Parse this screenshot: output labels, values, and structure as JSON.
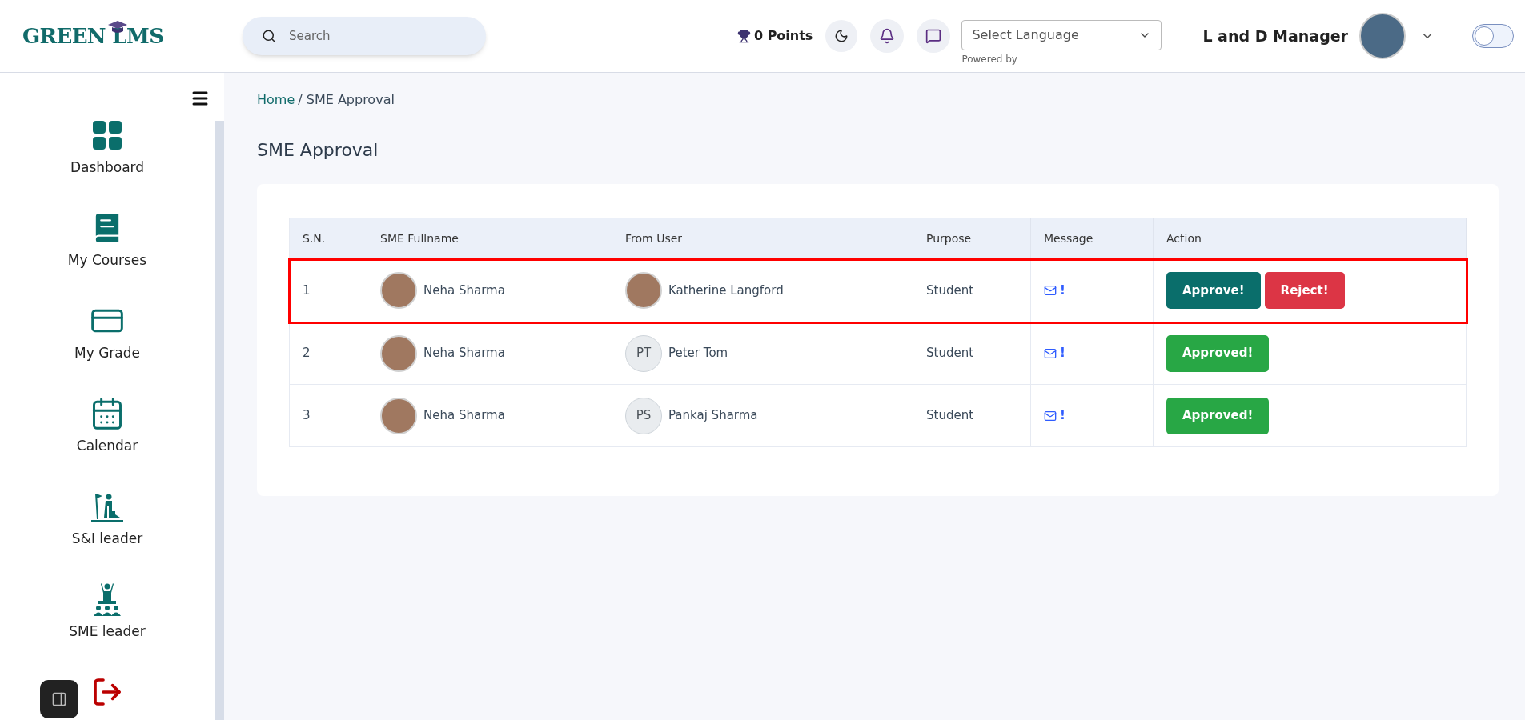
{
  "header": {
    "logo": "GREEN LMS",
    "search": {
      "placeholder": "Search"
    },
    "points": "0 Points",
    "language": {
      "value": "Select Language",
      "note": "Powered by"
    },
    "user": "L and D Manager",
    "toggle": {
      "on": false
    }
  },
  "sidebar": {
    "items": [
      {
        "label": "Dashboard",
        "kind": "grid"
      },
      {
        "label": "My Courses",
        "kind": "book"
      },
      {
        "label": "My Grade",
        "kind": "card"
      },
      {
        "label": "Calendar",
        "kind": "calendar"
      },
      {
        "label": "S&I leader",
        "kind": "climber"
      },
      {
        "label": "SME leader",
        "kind": "leader"
      },
      {
        "kind": "logout"
      }
    ]
  },
  "breadcrumb": {
    "home": "Home",
    "current": "/ SME Approval"
  },
  "page_title": "SME Approval",
  "table": {
    "columns": [
      "S.N.",
      "SME Fullname",
      "From User",
      "Purpose",
      "Message",
      "Action"
    ],
    "rows": [
      {
        "sn": "1",
        "sme": {
          "name": "Neha Sharma",
          "kind": "photo"
        },
        "from": {
          "name": "Katherine Langford",
          "kind": "photo"
        },
        "purpose": "Student",
        "message": "!",
        "highlighted": true,
        "actions": [
          {
            "label": "Approve!",
            "kind": "approve"
          },
          {
            "label": "Reject!",
            "kind": "reject"
          }
        ]
      },
      {
        "sn": "2",
        "sme": {
          "name": "Neha Sharma",
          "kind": "photo"
        },
        "from": {
          "name": "Peter Tom",
          "kind": "initials",
          "initials": "PT"
        },
        "purpose": "Student",
        "message": "!",
        "highlighted": false,
        "actions": [
          {
            "label": "Approved!",
            "kind": "approved"
          }
        ]
      },
      {
        "sn": "3",
        "sme": {
          "name": "Neha Sharma",
          "kind": "photo"
        },
        "from": {
          "name": "Pankaj Sharma",
          "kind": "initials",
          "initials": "PS"
        },
        "purpose": "Student",
        "message": "!",
        "highlighted": false,
        "actions": [
          {
            "label": "Approved!",
            "kind": "approved"
          }
        ]
      }
    ]
  }
}
